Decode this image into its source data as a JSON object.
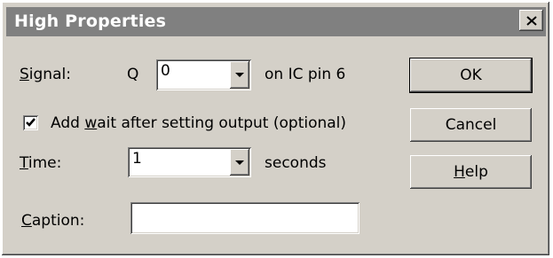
{
  "window": {
    "title": "High Properties",
    "close_icon": "close-icon"
  },
  "signal": {
    "label_first": "S",
    "label_rest": "ignal:",
    "prefix": "Q",
    "value": "0",
    "suffix": "on IC pin 6"
  },
  "wait": {
    "checked": true,
    "label_pre": "Add ",
    "label_accel": "w",
    "label_post": "ait after setting output (optional)"
  },
  "time": {
    "label_first": "T",
    "label_rest": "ime:",
    "value": "1",
    "suffix": "seconds"
  },
  "caption": {
    "label_first": "C",
    "label_rest": "aption:",
    "value": ""
  },
  "buttons": {
    "ok": "OK",
    "cancel": "Cancel",
    "help_first": "H",
    "help_rest": "elp"
  }
}
